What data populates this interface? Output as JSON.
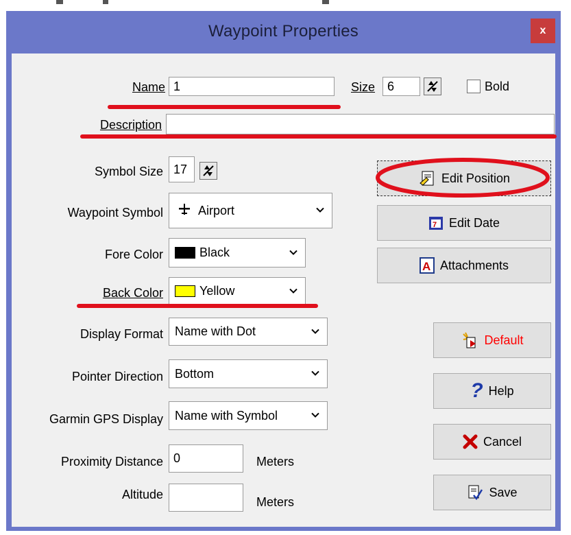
{
  "window": {
    "title": "Waypoint Properties",
    "close_label": "x"
  },
  "form": {
    "name": {
      "label": "Name",
      "value": "1"
    },
    "size": {
      "label": "Size",
      "value": "6"
    },
    "bold": {
      "label": "Bold",
      "checked": false
    },
    "description": {
      "label": "Description",
      "value": ""
    },
    "symbol_size": {
      "label": "Symbol Size",
      "value": "17"
    },
    "waypoint_symbol": {
      "label": "Waypoint Symbol",
      "value": "Airport",
      "icon": "airplane-icon"
    },
    "fore_color": {
      "label": "Fore Color",
      "value": "Black",
      "swatch": "#000000"
    },
    "back_color": {
      "label": "Back Color",
      "value": "Yellow",
      "swatch": "#ffff00"
    },
    "display_format": {
      "label": "Display Format",
      "value": "Name with Dot"
    },
    "pointer_direction": {
      "label": "Pointer Direction",
      "value": "Bottom"
    },
    "garmin_display": {
      "label": "Garmin GPS Display",
      "value": "Name with Symbol"
    },
    "proximity": {
      "label": "Proximity Distance",
      "value": "0",
      "unit": "Meters"
    },
    "altitude": {
      "label": "Altitude",
      "value": "",
      "unit": "Meters"
    }
  },
  "buttons": {
    "edit_position": "Edit Position",
    "edit_date": "Edit Date",
    "attachments": "Attachments",
    "default": "Default",
    "help": "Help",
    "cancel": "Cancel",
    "save": "Save"
  },
  "colors": {
    "frame": "#6b78c9",
    "dialog_bg": "#f0f0f0",
    "annotation": "#e0101c",
    "default_text": "#ff0000"
  }
}
